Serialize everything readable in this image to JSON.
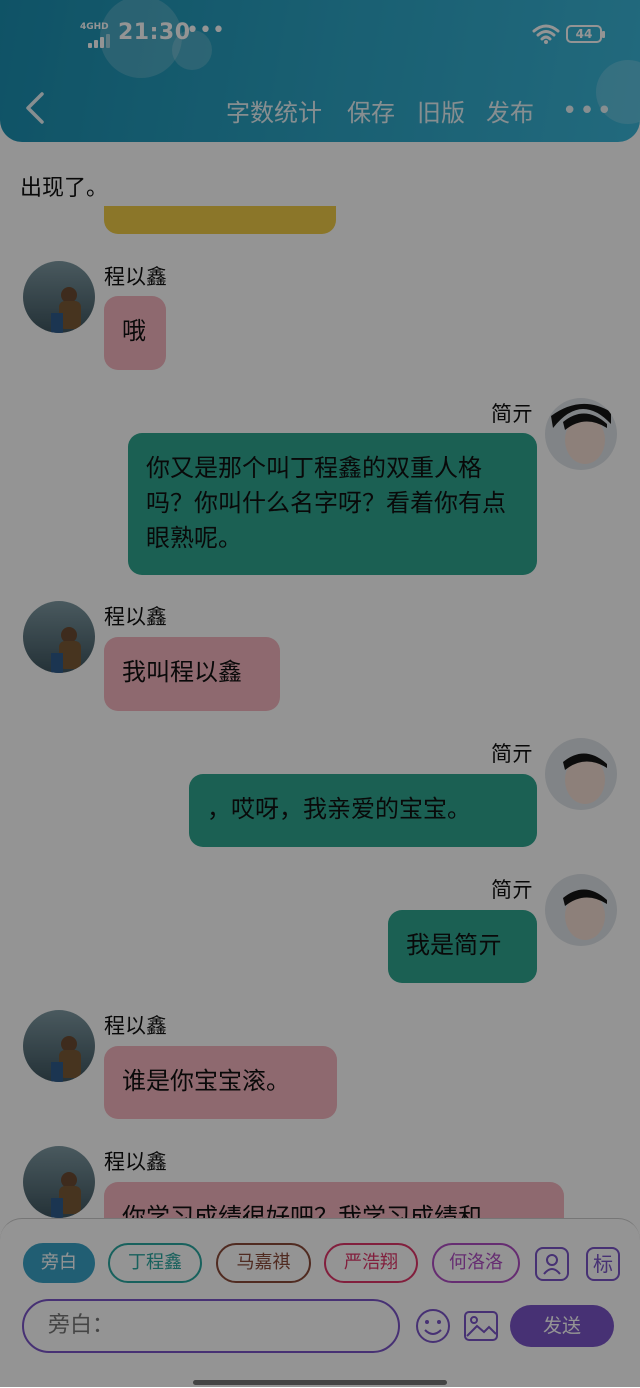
{
  "status_bar": {
    "time": "21:30",
    "dots": "•••",
    "network": "4GHD",
    "battery": "44"
  },
  "toolbar": {
    "items": [
      "字数统计",
      "保存",
      "旧版",
      "发布"
    ],
    "more": "•••"
  },
  "chat": {
    "intro_text": "出现了。",
    "messages": [
      {
        "speaker": "程以鑫",
        "text": "哦"
      },
      {
        "speaker": "简亓",
        "text": "你又是那个叫丁程鑫的双重人格吗？你叫什么名字呀？看着你有点眼熟呢。"
      },
      {
        "speaker": "程以鑫",
        "text": "我叫程以鑫"
      },
      {
        "speaker": "简亓",
        "text": "，哎呀，我亲爱的宝宝。"
      },
      {
        "speaker": "简亓",
        "text": "我是简亓"
      },
      {
        "speaker": "程以鑫",
        "text": "谁是你宝宝滚。"
      },
      {
        "speaker": "程以鑫",
        "text": "你学习成绩很好吧？我学习成绩和"
      }
    ]
  },
  "roles": [
    {
      "label": "旁白",
      "color": "#3aa3c6"
    },
    {
      "label": "丁程鑫",
      "color": "#2aa7a0"
    },
    {
      "label": "马嘉祺",
      "color": "#8a4a3a"
    },
    {
      "label": "严浩翔",
      "color": "#e0366a"
    },
    {
      "label": "何洛洛",
      "color": "#b04fc4"
    }
  ],
  "extra_buttons": {
    "tag": "标"
  },
  "input": {
    "placeholder": "旁白："
  },
  "send_label": "发送",
  "colors": {
    "header": "#2aa2c2",
    "accent": "#7a55c8",
    "pink_bubble": "#f4b6bf",
    "teal_bubble": "#2fa58f"
  }
}
